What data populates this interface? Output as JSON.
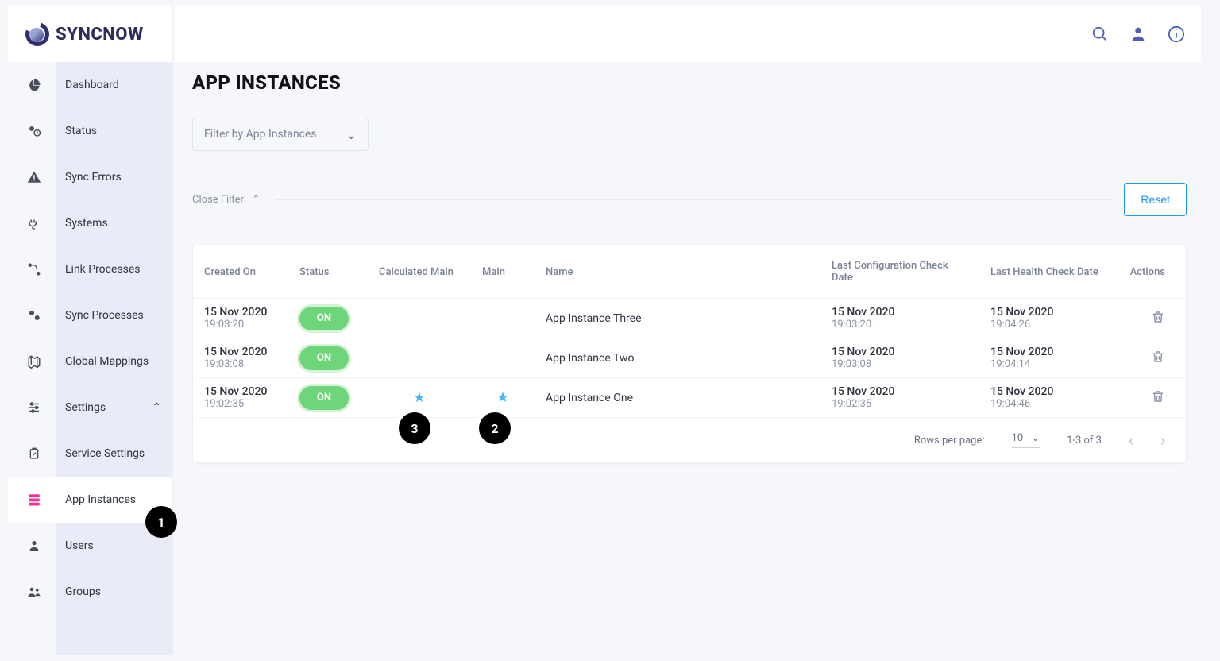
{
  "brand": "SYNCNOW",
  "topbar_icons": [
    "search",
    "user",
    "info"
  ],
  "sidebar": [
    {
      "label": "Dashboard",
      "icon": "pie"
    },
    {
      "label": "Status",
      "icon": "gears-clock"
    },
    {
      "label": "Sync Errors",
      "icon": "warning"
    },
    {
      "label": "Systems",
      "icon": "plug"
    },
    {
      "label": "Link Processes",
      "icon": "flow"
    },
    {
      "label": "Sync Processes",
      "icon": "gears"
    },
    {
      "label": "Global Mappings",
      "icon": "map"
    },
    {
      "label": "Settings",
      "icon": "sliders",
      "expanded": true
    },
    {
      "label": "Service Settings",
      "icon": "clipboard"
    },
    {
      "label": "App Instances",
      "icon": "servers",
      "active": true
    },
    {
      "label": "Users",
      "icon": "user"
    },
    {
      "label": "Groups",
      "icon": "group"
    }
  ],
  "page": {
    "title": "APP INSTANCES",
    "filter_placeholder": "Filter by App Instances",
    "close_filter": "Close Filter",
    "reset": "Reset"
  },
  "table": {
    "columns": [
      "Created On",
      "Status",
      "Calculated Main",
      "Main",
      "Name",
      "Last Configuration Check Date",
      "Last Health Check Date",
      "Actions"
    ],
    "rows": [
      {
        "created_date": "15 Nov 2020",
        "created_time": "19:03:20",
        "status": "ON",
        "calc_main": false,
        "main": false,
        "name": "App Instance Three",
        "cfg_date": "15 Nov 2020",
        "cfg_time": "19:03:20",
        "health_date": "15 Nov 2020",
        "health_time": "19:04:26"
      },
      {
        "created_date": "15 Nov 2020",
        "created_time": "19:03:08",
        "status": "ON",
        "calc_main": false,
        "main": false,
        "name": "App Instance Two",
        "cfg_date": "15 Nov 2020",
        "cfg_time": "19:03:08",
        "health_date": "15 Nov 2020",
        "health_time": "19:04:14"
      },
      {
        "created_date": "15 Nov 2020",
        "created_time": "19:02:35",
        "status": "ON",
        "calc_main": true,
        "main": true,
        "name": "App Instance One",
        "cfg_date": "15 Nov 2020",
        "cfg_time": "19:02:35",
        "health_date": "15 Nov 2020",
        "health_time": "19:04:46"
      }
    ]
  },
  "pager": {
    "rows_per_page_label": "Rows per page:",
    "rows_per_page": "10",
    "range": "1-3 of 3"
  },
  "callouts": {
    "1": "1",
    "2": "2",
    "3": "3"
  }
}
